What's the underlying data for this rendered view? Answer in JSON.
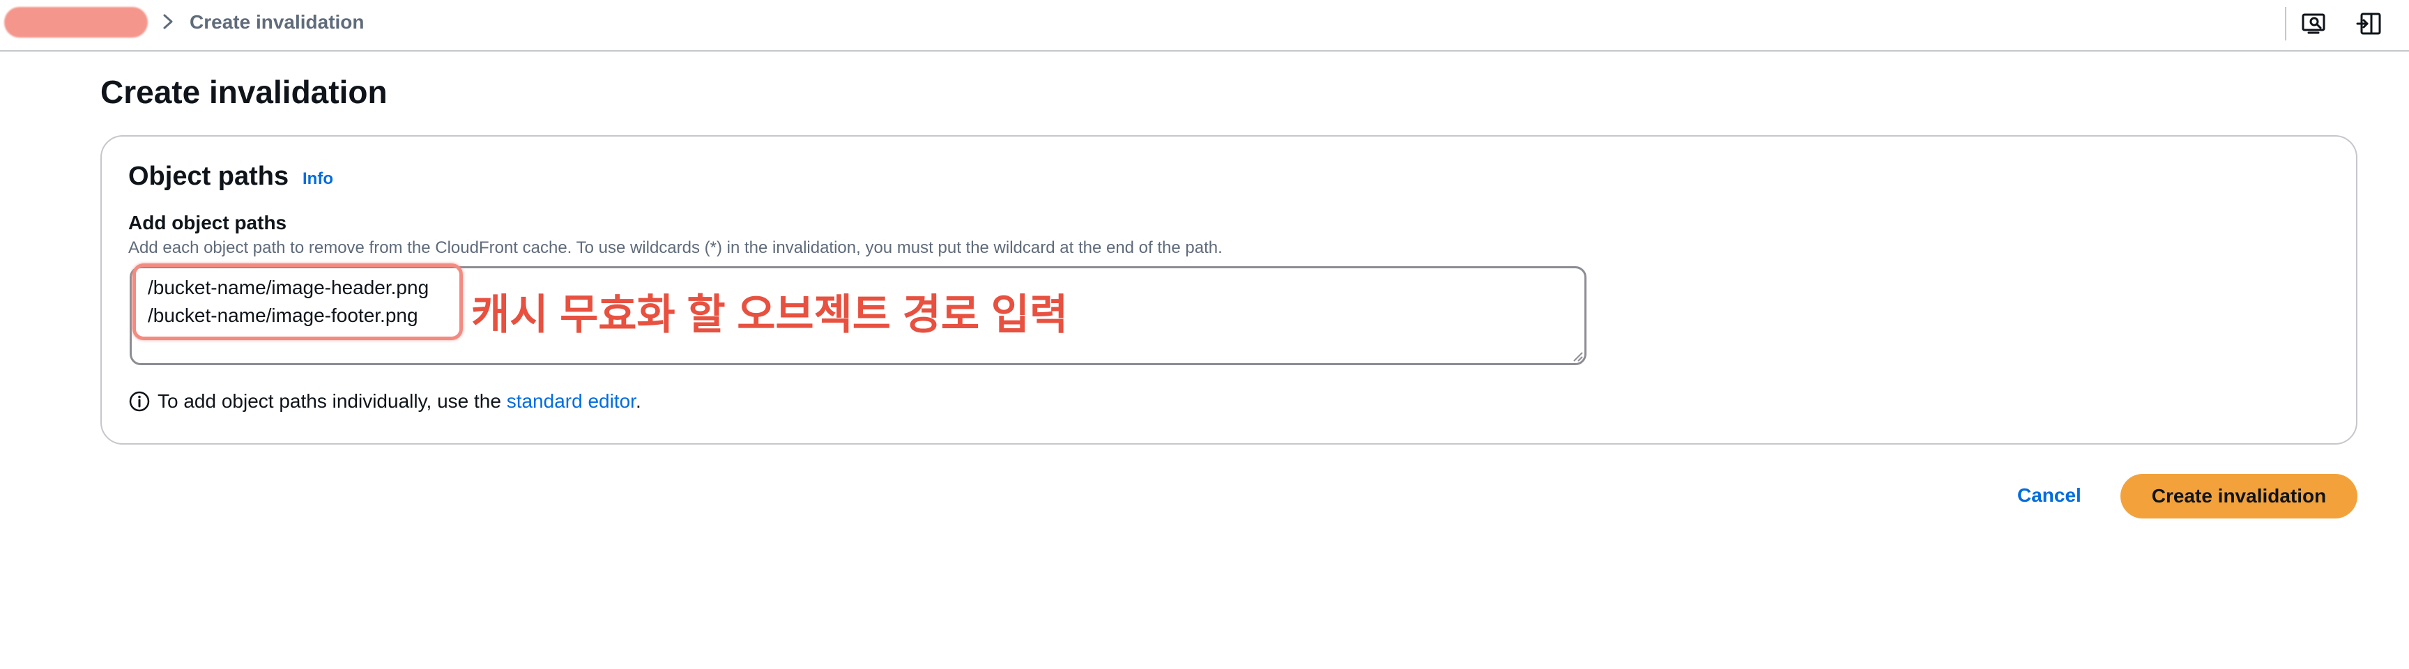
{
  "breadcrumb": {
    "current": "Create invalidation"
  },
  "toolbar": {
    "icons": [
      "screen-search-icon",
      "panel-toggle-icon"
    ]
  },
  "page": {
    "title": "Create invalidation"
  },
  "panel": {
    "title": "Object paths",
    "info_label": "Info",
    "field_label": "Add object paths",
    "field_description": "Add each object path to remove from the CloudFront cache. To use wildcards (*) in the invalidation, you must put the wildcard at the end of the path.",
    "paths": [
      "/bucket-name/image-header.png",
      "/bucket-name/image-footer.png"
    ],
    "annotation": "캐시 무효화 할 오브젝트 경로 입력",
    "hint_prefix": "To add object paths individually, use the ",
    "hint_link": "standard editor",
    "hint_suffix": "."
  },
  "actions": {
    "cancel_label": "Cancel",
    "submit_label": "Create invalidation"
  },
  "colors": {
    "accent": "#006ce0",
    "primary_button": "#f3a23b",
    "annotation": "#e8503f",
    "highlight": "#f28b81"
  }
}
